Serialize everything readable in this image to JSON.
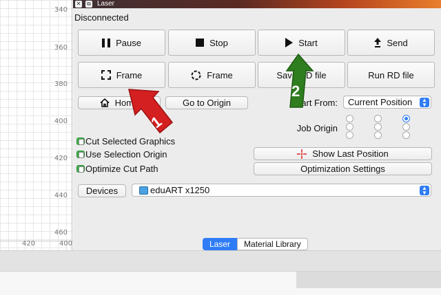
{
  "ruler": {
    "y_ticks": [
      "340",
      "360",
      "380",
      "400",
      "420",
      "440",
      "460"
    ],
    "x_ticks": [
      "420",
      "400"
    ]
  },
  "window": {
    "title": "Laser",
    "status": "Disconnected"
  },
  "buttons": {
    "pause": "Pause",
    "stop": "Stop",
    "start": "Start",
    "send": "Send",
    "frame1": "Frame",
    "frame2": "Frame",
    "save_rd": "Save RD file",
    "run_rd": "Run RD file",
    "home": "Home",
    "go_origin": "Go to Origin",
    "show_last_position": "Show Last Position",
    "optimization_settings": "Optimization Settings",
    "devices": "Devices"
  },
  "start_from": {
    "label": "Start From:",
    "value": "Current Position"
  },
  "job_origin": {
    "label": "Job Origin",
    "selected": "top-right"
  },
  "checkboxes": [
    {
      "label": "Cut Selected Graphics"
    },
    {
      "label": "Use Selection Origin"
    },
    {
      "label": "Optimize Cut Path"
    }
  ],
  "device_select": {
    "value": "eduART x1250"
  },
  "tabs": [
    {
      "label": "Laser",
      "active": true
    },
    {
      "label": "Material Library",
      "active": false
    }
  ],
  "annotations": {
    "arrow1_number": "1",
    "arrow2_number": "2",
    "arrow1_color": "#d42020",
    "arrow2_color": "#2e7d1e"
  },
  "colors": {
    "accent": "#2f7cf6",
    "check_green": "#3cb34a"
  }
}
